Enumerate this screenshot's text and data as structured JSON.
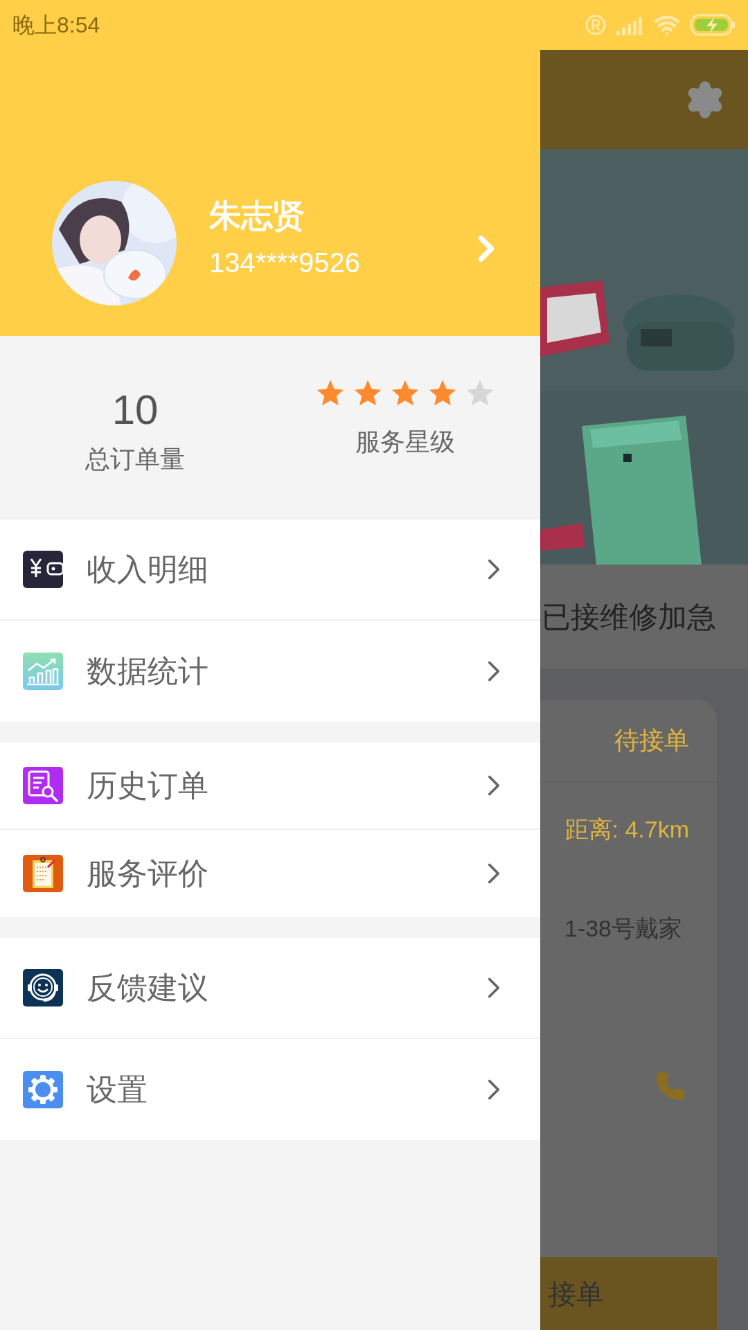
{
  "status_bar": {
    "time": "晚上8:54"
  },
  "profile": {
    "name": "朱志贤",
    "phone": "134****9526"
  },
  "stats": {
    "orders": {
      "value": "10",
      "label": "总订单量"
    },
    "rating": {
      "stars": 4,
      "label": "服务星级"
    }
  },
  "menu_groups": [
    [
      {
        "label": "收入明细"
      },
      {
        "label": "数据统计"
      }
    ],
    [
      {
        "label": "历史订单"
      },
      {
        "label": "服务评价"
      }
    ],
    [
      {
        "label": "反馈建议"
      },
      {
        "label": "设置"
      }
    ]
  ],
  "background": {
    "notice": "已接维修加急",
    "order_card": {
      "status": "待接单",
      "distance": "距离: 4.7km",
      "address": "1-38号戴家",
      "button": "接单"
    }
  }
}
